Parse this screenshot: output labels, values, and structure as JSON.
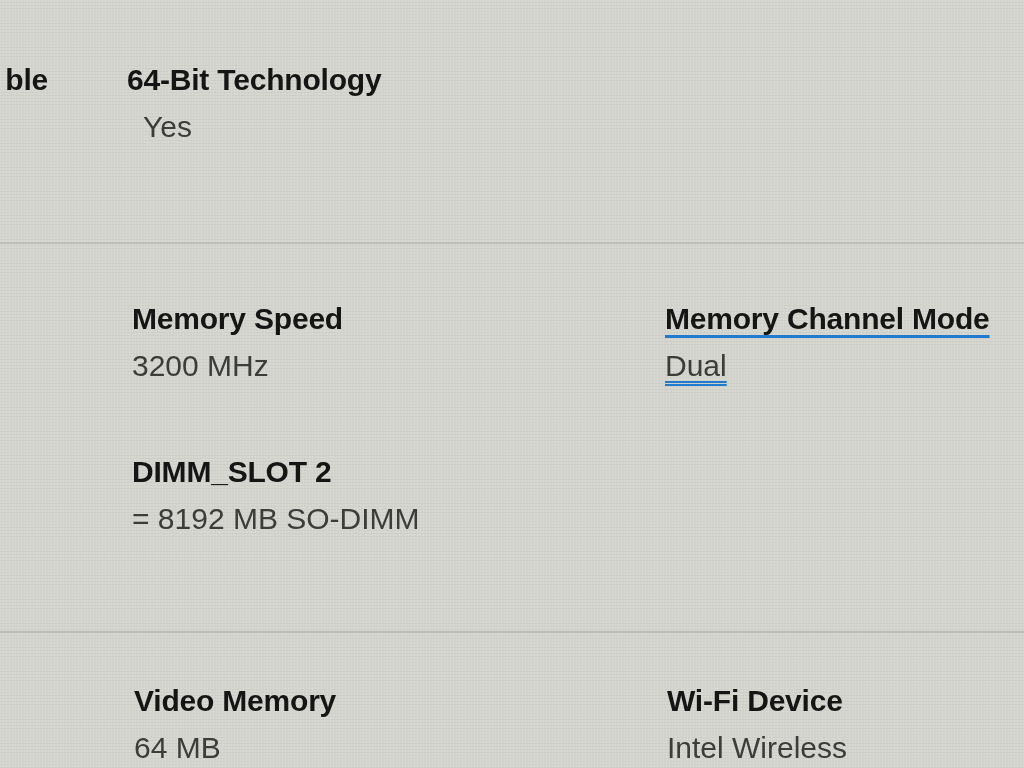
{
  "sections": [
    {
      "fields": [
        {
          "label": "ble"
        },
        {
          "label": "64-Bit Technology",
          "value": "Yes"
        }
      ]
    },
    {
      "fields": [
        {
          "label": "Memory Speed",
          "value": "3200 MHz"
        },
        {
          "label": "Memory Channel Mode",
          "value": "Dual",
          "label_underlined": true,
          "value_double_underlined": true
        },
        {
          "label": "DIMM_SLOT 2",
          "value": "= 8192 MB SO-DIMM"
        }
      ]
    },
    {
      "fields": [
        {
          "label": "Video Memory",
          "value": "64 MB"
        },
        {
          "label": "Wi-Fi Device",
          "value": "Intel Wireless"
        }
      ]
    }
  ]
}
